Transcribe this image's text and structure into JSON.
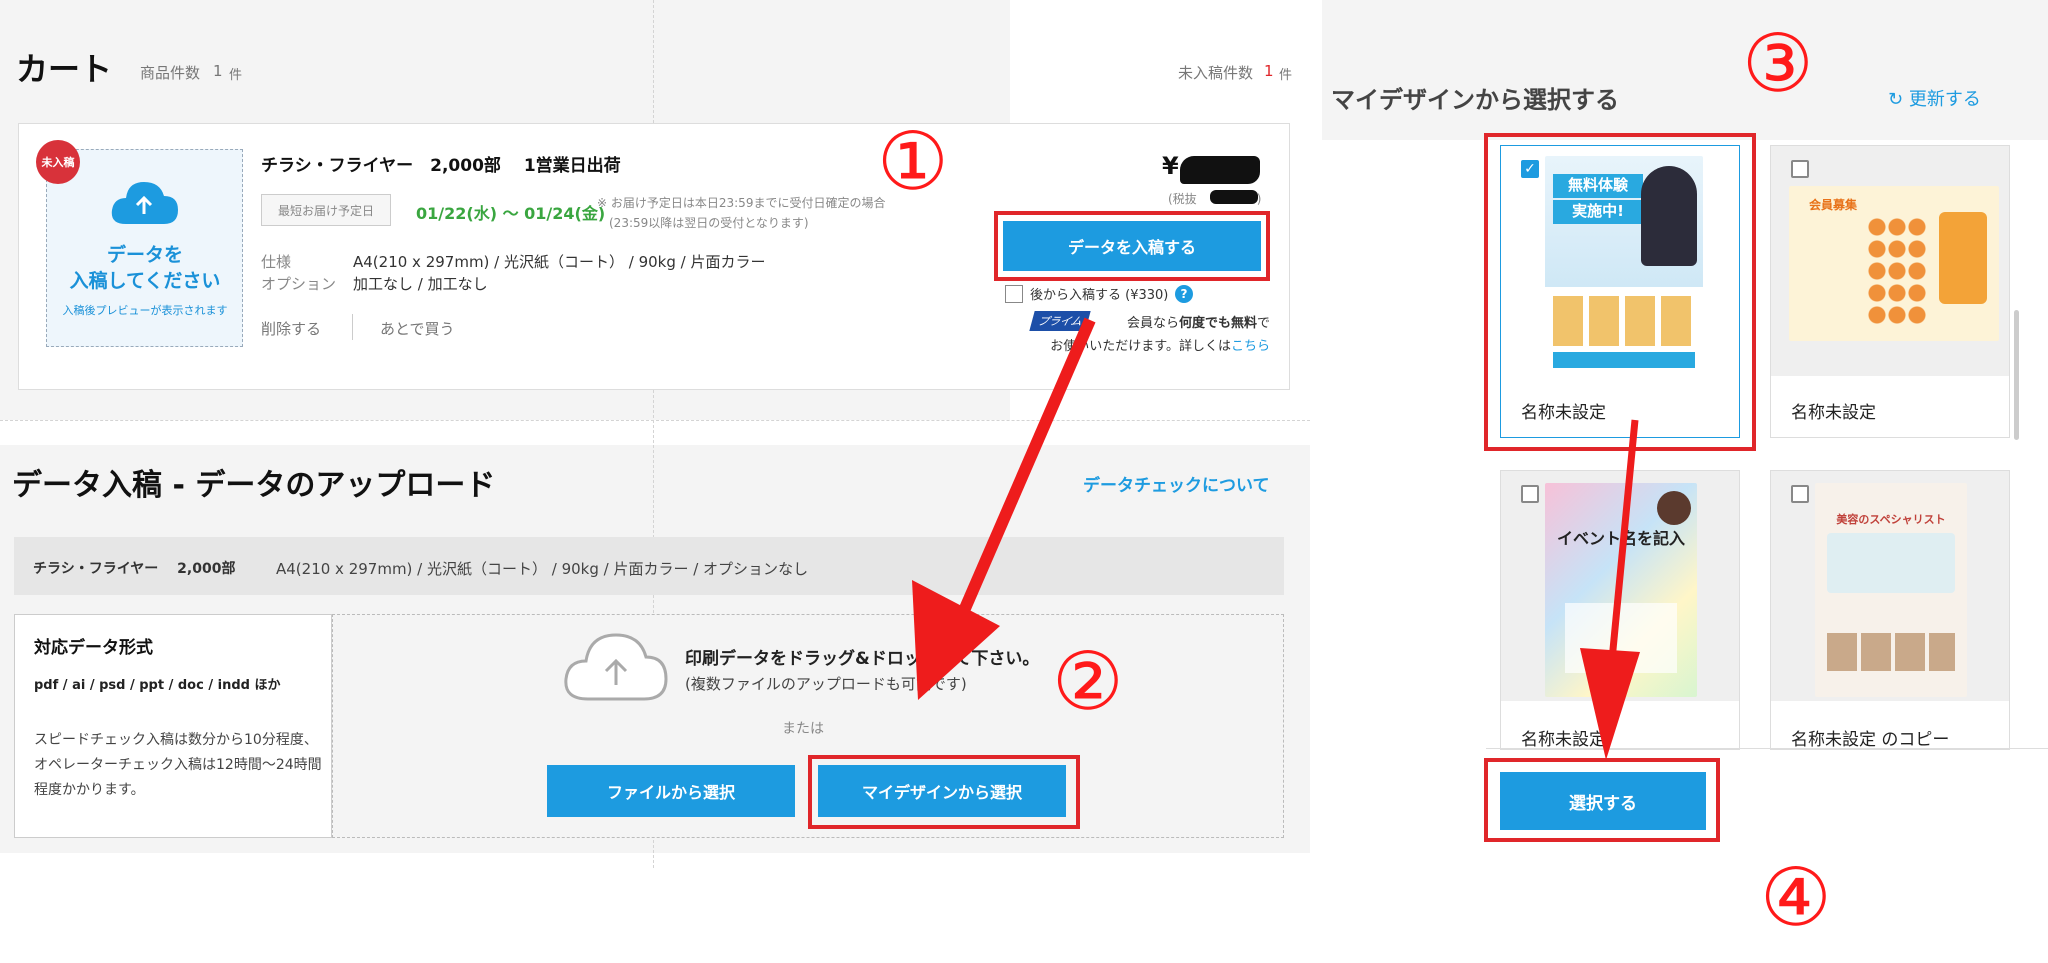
{
  "cart": {
    "title": "カート",
    "count_label": "商品件数",
    "count_value": "1",
    "count_unit": "件",
    "pending_label": "未入稿件数",
    "pending_value": "1",
    "pending_unit": "件",
    "item": {
      "badge": "未入稿",
      "preview_prompt_line1": "データを",
      "preview_prompt_line2": "入稿してください",
      "preview_note": "入稿後プレビューが表示されます",
      "title": "チラシ・フライヤー　2,000部　 1営業日出荷",
      "delivery_tag": "最短お届け予定日",
      "delivery_date": "01/22(水) 〜 01/24(金)",
      "delivery_note_line1": "※ お届け予定日は本日23:59までに受付日確定の場合",
      "delivery_note_line2": "(23:59以降は翌日の受付となります)",
      "spec_label": "仕様",
      "spec_value": "A4(210 x 297mm) / 光沢紙（コート） / 90kg / 片面カラー",
      "option_label": "オプション",
      "option_value": "加工なし / 加工なし",
      "delete_label": "削除する",
      "later_label": "あとで買う",
      "price_symbol": "¥",
      "tax_note_open": "(税抜",
      "tax_note_close": ")",
      "enter_data_button": "データを入稿する",
      "later_checkbox_label": "後から入稿する (¥330)",
      "help_icon": "?",
      "prime_badge": "プライム",
      "prime_note_a": "会員なら",
      "prime_note_b": "何度でも無料",
      "prime_note_c": "で",
      "prime_note_d": "お使いいただけます。詳しくは",
      "prime_link": "こちら"
    }
  },
  "upload": {
    "title": "データ入稿 - データのアップロード",
    "check_link": "データチェックについて",
    "product_title": "チラシ・フライヤー　 2,000部",
    "product_spec": "A4(210 x 297mm) / 光沢紙（コート） / 90kg / 片面カラー / オプションなし",
    "format_title": "対応データ形式",
    "format_list": "pdf / ai / psd / ppt / doc / indd ほか",
    "format_note": "スピードチェック入稿は数分から10分程度、オペレーターチェック入稿は12時間〜24時間程度かかります。",
    "drop_title": "印刷データをドラッグ&ドロップして下さい。",
    "drop_sub": "(複数ファイルのアップロードも可能です)",
    "or": "または",
    "file_button": "ファイルから選択",
    "mydesign_button": "マイデザインから選択"
  },
  "mydesign": {
    "title": "マイデザインから選択する",
    "refresh": "更新する",
    "refresh_icon": "↻",
    "cards": [
      {
        "label": "名称未設定",
        "checked": true
      },
      {
        "label": "名称未設定",
        "checked": false
      },
      {
        "label": "名称未設定",
        "checked": false
      },
      {
        "label": "名称未設定 のコピー",
        "checked": false
      }
    ],
    "select_button": "選択する"
  },
  "thumbnails": {
    "t1_line1": "無料体験",
    "t1_line2": "実施中!",
    "t2_line1": "会員募集",
    "t3_line1": "イベント名を記入",
    "t4_line1": "美容のスペシャリスト"
  },
  "annotations": [
    "①",
    "②",
    "③",
    "④"
  ],
  "colors": {
    "accent": "#1d9be0",
    "annotation_red": "#e0262a",
    "delivery_green": "#3aa640",
    "badge_red": "#d8323a"
  }
}
